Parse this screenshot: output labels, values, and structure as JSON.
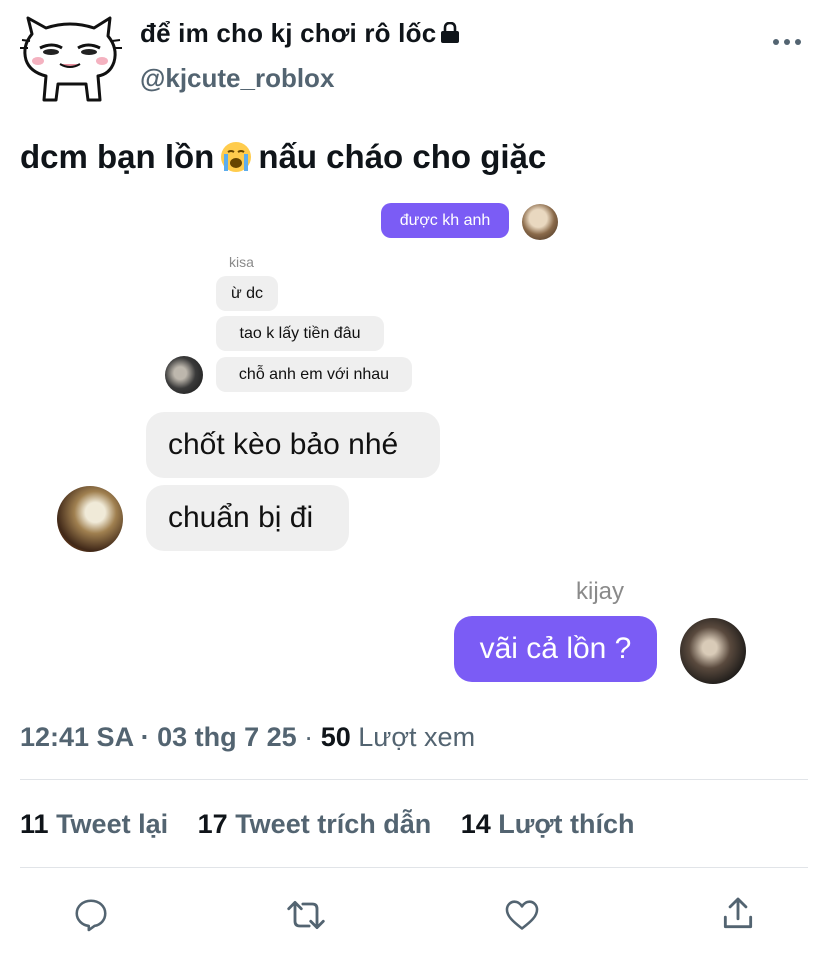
{
  "author": {
    "display_name": "để im cho kj chơi rô lốc",
    "handle": "@kjcute_roblox",
    "avatar_icon": "cat-face-avatar",
    "lock_icon": "lock-icon"
  },
  "tweet": {
    "text_before": "dcm bạn lồn",
    "emoji": "loudly-crying-face",
    "text_after": "nấu cháo cho giặc"
  },
  "chat": {
    "top_bubble": "được kh anh",
    "kisa_name": "kisa",
    "kisa_messages": [
      "ừ dc",
      "tao k lấy tiền đâu",
      "chỗ anh em với nhau"
    ],
    "big_messages": [
      "chốt kèo bảo nhé",
      "chuẩn bị đi"
    ],
    "kijay_name": "kijay",
    "kijay_message": "vãi cả lồn ?",
    "accent": "#7b5cf5"
  },
  "meta": {
    "time": "12:41 SA",
    "date": "03 thg 7 25",
    "views_count": "50",
    "views_label": "Lượt xem"
  },
  "stats": {
    "retweets_count": "11",
    "retweets_label": "Tweet lại",
    "quotes_count": "17",
    "quotes_label": "Tweet trích dẫn",
    "likes_count": "14",
    "likes_label": "Lượt thích"
  },
  "actions": [
    "reply-icon",
    "retweet-icon",
    "like-icon",
    "share-icon"
  ]
}
